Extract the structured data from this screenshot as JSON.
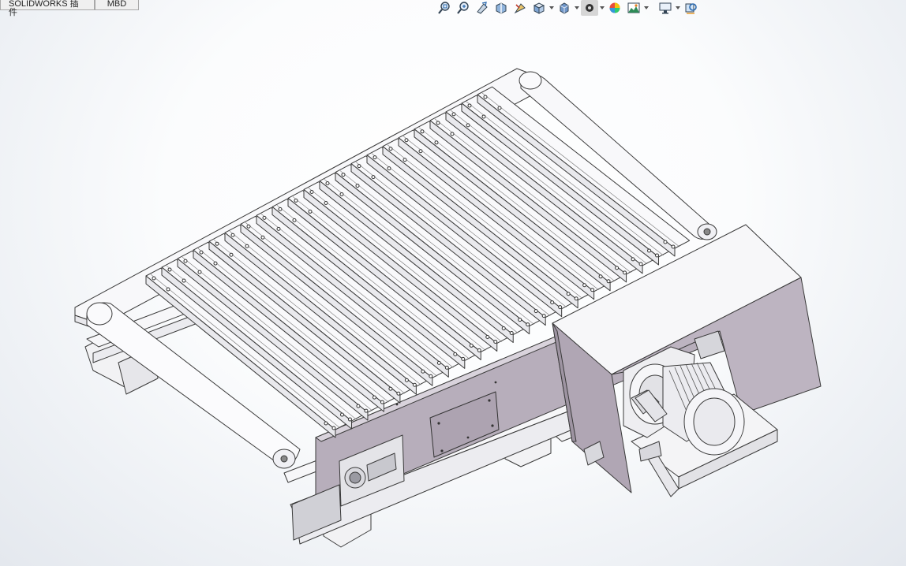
{
  "tabs": [
    {
      "label": "SOLIDWORKS 插件"
    },
    {
      "label": "MBD"
    }
  ],
  "hud_icons": [
    "zoom-to-fit-icon",
    "zoom-to-area-icon",
    "previous-view-icon",
    "section-view-icon",
    "dynamic-annotation-icon",
    "view-orientation-icon",
    "display-style-icon",
    "hide-show-items-icon",
    "edit-appearance-icon",
    "apply-scene-icon",
    "view-settings-icon",
    "realview-icon"
  ],
  "colors": {
    "model_line": "#3a3a3a",
    "model_face": "#f4f4f6",
    "frame_face": "#b9b0bd",
    "frame_dark": "#a69ca9",
    "roller_face": "#f7f7f9"
  }
}
